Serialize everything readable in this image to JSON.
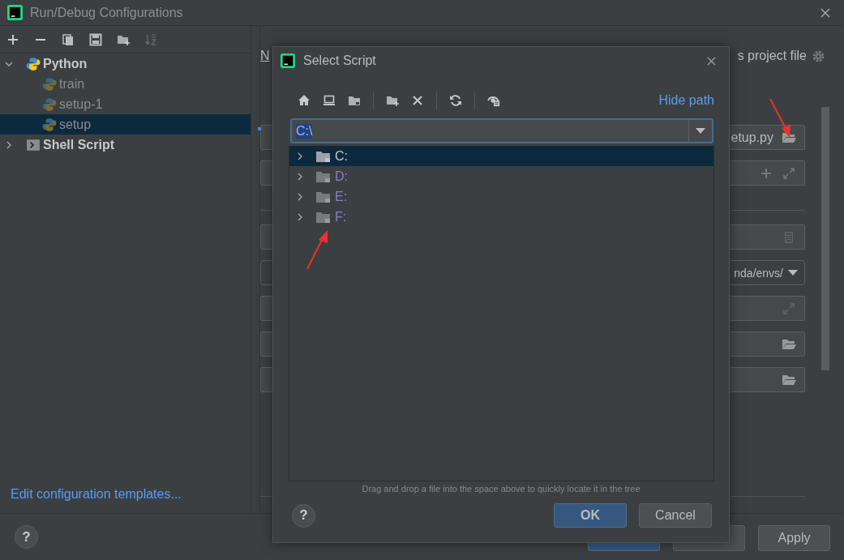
{
  "window": {
    "title": "Run/Debug Configurations"
  },
  "tree": [
    {
      "label": "Python",
      "expanded": true,
      "selected": false,
      "children": [
        {
          "label": "train",
          "selected": false
        },
        {
          "label": "setup-1",
          "selected": false
        },
        {
          "label": "setup",
          "selected": true
        }
      ]
    },
    {
      "label": "Shell Script",
      "expanded": false,
      "selected": false
    }
  ],
  "templates_link": "Edit configuration templates...",
  "settings": {
    "name_label": "N",
    "store_option": "s project file",
    "fields": [
      {
        "kind": "browse",
        "value": "etup.py"
      },
      {
        "kind": "add-expand"
      },
      {
        "kind": "divider"
      },
      {
        "kind": "document"
      },
      {
        "kind": "dropdown",
        "value": "nda/envs/"
      },
      {
        "kind": "expand"
      },
      {
        "kind": "browse"
      },
      {
        "kind": "browse"
      }
    ]
  },
  "help_button": "?",
  "footer_buttons": [
    {
      "kind": "primary"
    },
    {
      "kind": "default"
    },
    {
      "kind": "default",
      "label": "Apply"
    }
  ],
  "dialog": {
    "title": "Select Script",
    "hide_path_link": "Hide path",
    "path": {
      "value": "C:\\",
      "selected": true
    },
    "drives": [
      {
        "label": "C:",
        "selected": true
      },
      {
        "label": "D:",
        "selected": false
      },
      {
        "label": "E:",
        "selected": false
      },
      {
        "label": "F:",
        "selected": false
      }
    ],
    "hint": "Drag and drop a file into the space above to quickly locate it in the tree",
    "help_button": "?",
    "buttons": [
      {
        "label": "OK",
        "kind": "primary"
      },
      {
        "label": "Cancel",
        "kind": "default"
      }
    ]
  }
}
